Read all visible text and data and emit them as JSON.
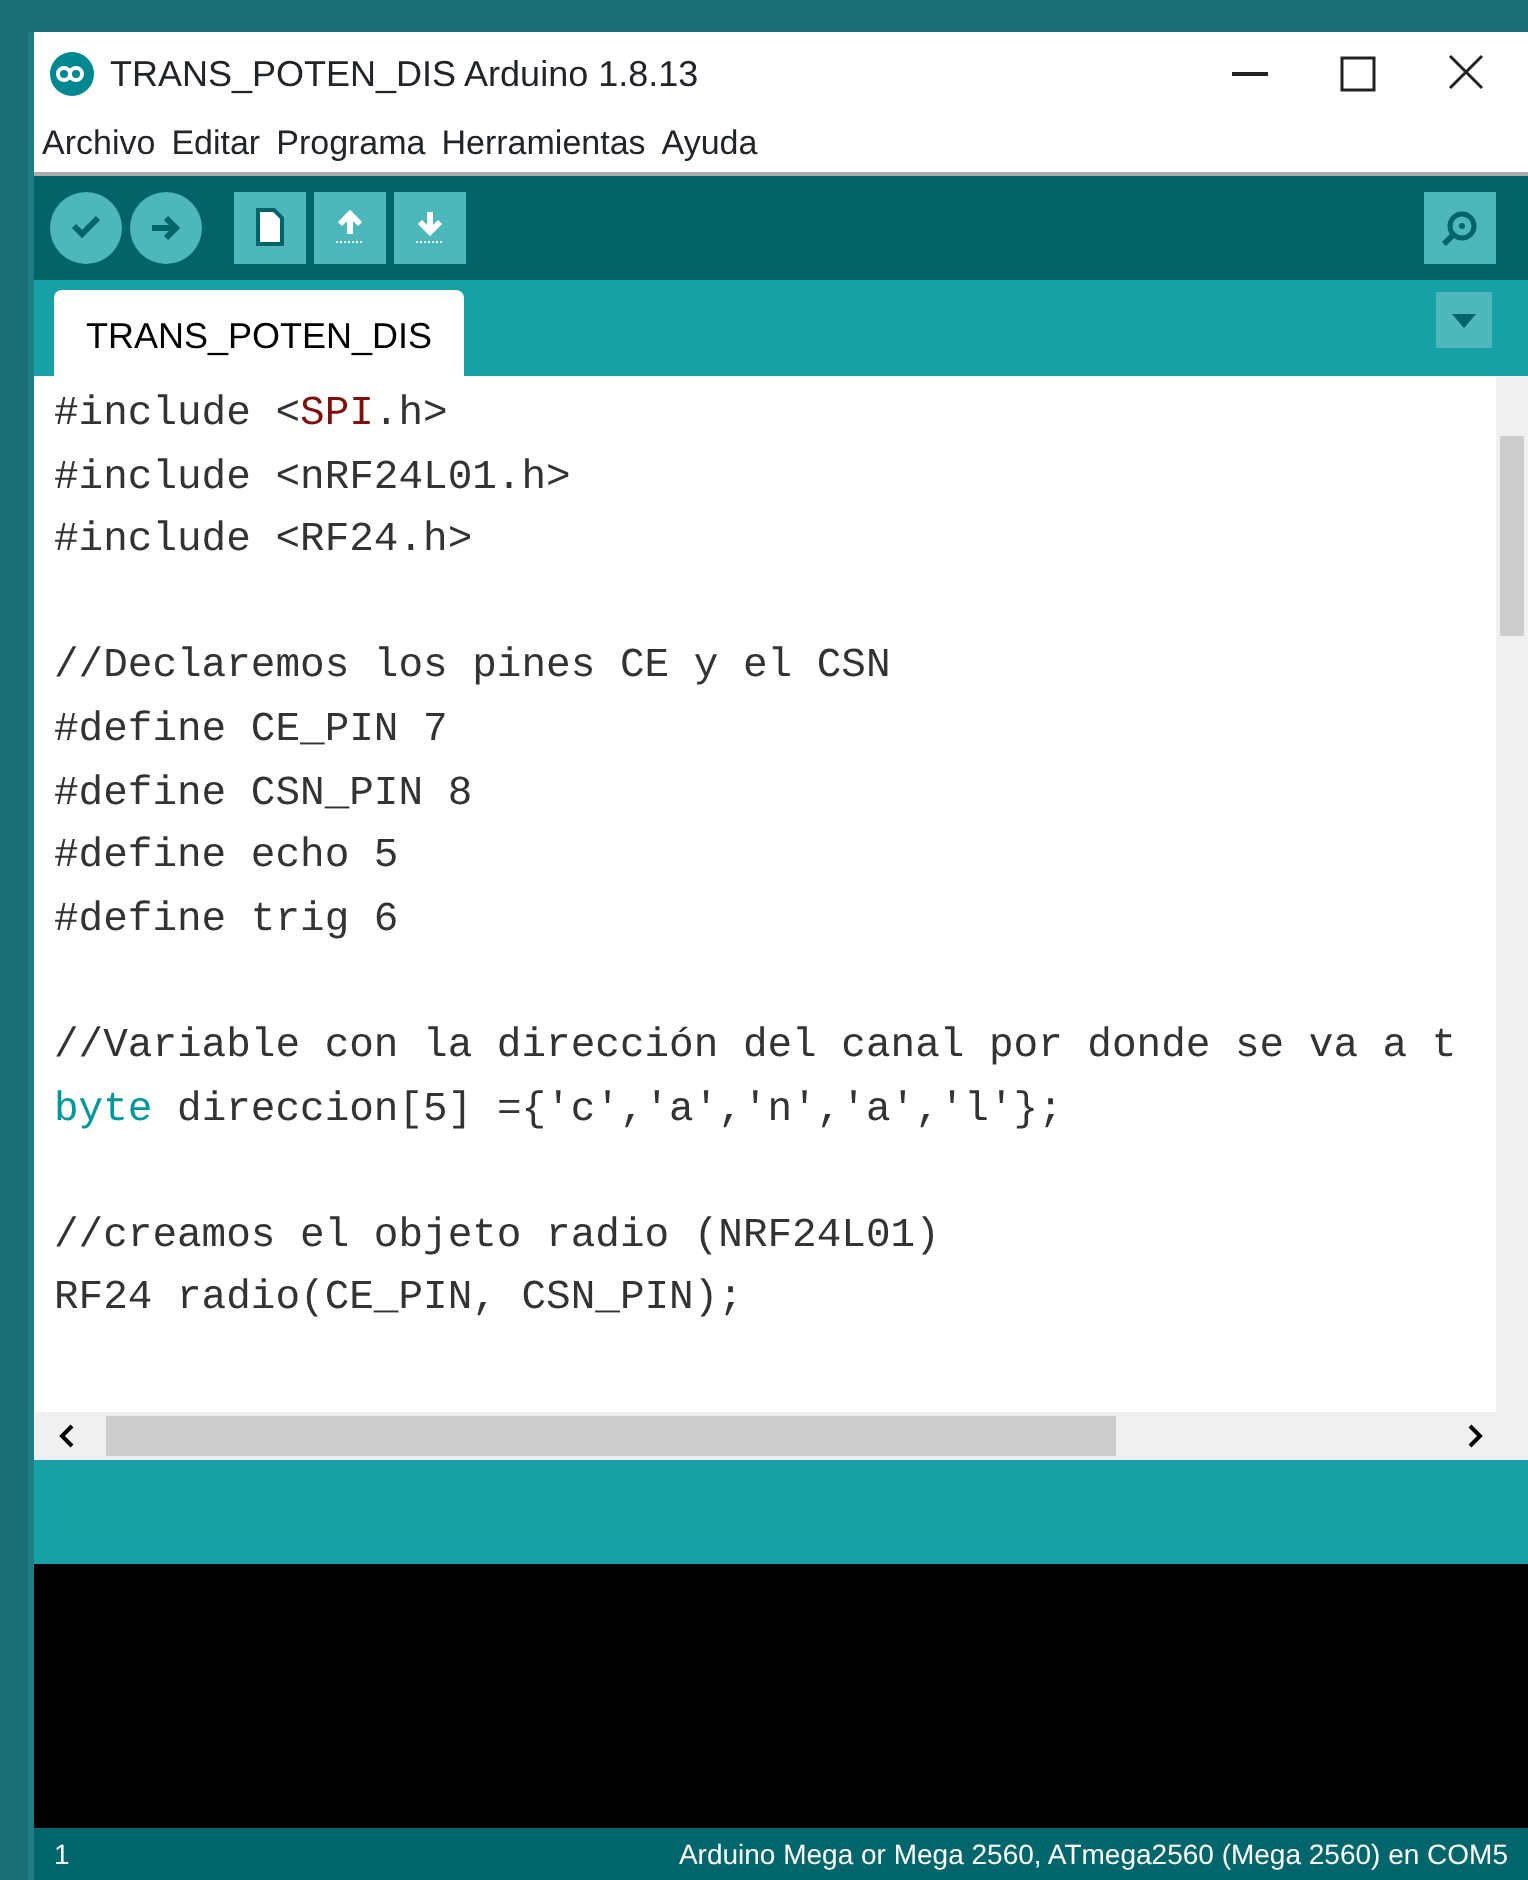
{
  "window": {
    "title": "TRANS_POTEN_DIS Arduino 1.8.13"
  },
  "menu": [
    "Archivo",
    "Editar",
    "Programa",
    "Herramientas",
    "Ayuda"
  ],
  "toolbar": [
    {
      "kind": "verify"
    },
    {
      "kind": "upload"
    },
    {
      "kind": "new"
    },
    {
      "kind": "open"
    },
    {
      "kind": "save"
    }
  ],
  "tabs": [
    {
      "label": "TRANS_POTEN_DIS",
      "selected": true
    }
  ],
  "editor": {
    "lines": [
      {
        "kind": "code",
        "segments": [
          {
            "text": "#include <",
            "kind": "plain"
          },
          {
            "text": "SPI",
            "kind": "library"
          },
          {
            "text": ".h>",
            "kind": "plain"
          }
        ]
      },
      {
        "kind": "code",
        "segments": [
          {
            "text": "#include <nRF24L01.h>",
            "kind": "plain"
          }
        ]
      },
      {
        "kind": "code",
        "segments": [
          {
            "text": "#include <RF24.h>",
            "kind": "plain"
          }
        ]
      },
      {
        "kind": "blank"
      },
      {
        "kind": "code",
        "segments": [
          {
            "text": "//Declaremos los pines CE y el CSN",
            "kind": "plain"
          }
        ]
      },
      {
        "kind": "code",
        "segments": [
          {
            "text": "#define CE_PIN 7",
            "kind": "plain"
          }
        ]
      },
      {
        "kind": "code",
        "segments": [
          {
            "text": "#define CSN_PIN 8",
            "kind": "plain"
          }
        ]
      },
      {
        "kind": "code",
        "segments": [
          {
            "text": "#define echo 5",
            "kind": "plain"
          }
        ]
      },
      {
        "kind": "code",
        "segments": [
          {
            "text": "#define trig 6",
            "kind": "plain"
          }
        ]
      },
      {
        "kind": "blank"
      },
      {
        "kind": "code",
        "segments": [
          {
            "text": "//Variable con la dirección del canal por donde se va a t",
            "kind": "plain"
          }
        ]
      },
      {
        "kind": "code",
        "segments": [
          {
            "text": "byte",
            "kind": "keyword"
          },
          {
            "text": " direccion[5] ={'c','a','n','a','l'};",
            "kind": "plain"
          }
        ]
      },
      {
        "kind": "blank"
      },
      {
        "kind": "code",
        "segments": [
          {
            "text": "//creamos el objeto radio (NRF24L01)",
            "kind": "plain"
          }
        ]
      },
      {
        "kind": "code",
        "segments": [
          {
            "text": "RF24 radio(CE_PIN, CSN_PIN);",
            "kind": "plain"
          }
        ]
      }
    ]
  },
  "status_bar": {
    "line": "1",
    "board": "Arduino Mega or Mega 2560, ATmega2560 (Mega 2560) en COM5"
  }
}
